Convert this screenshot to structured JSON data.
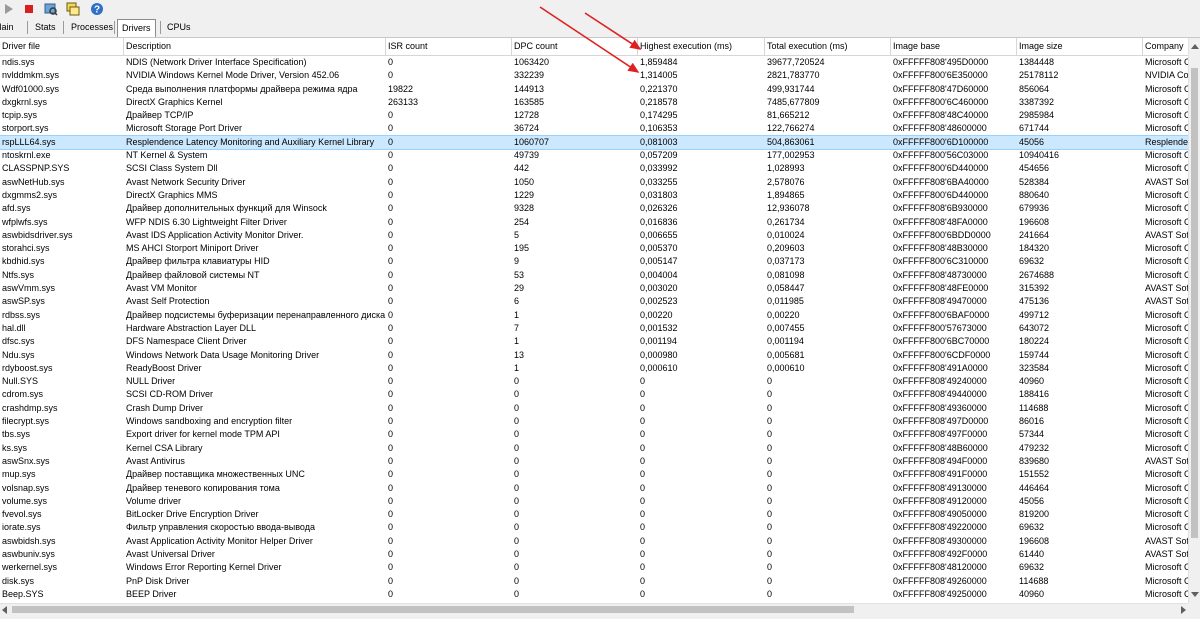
{
  "toolbar": {
    "icons": [
      "play-icon",
      "stop-icon",
      "driver-scan-icon",
      "window-icon",
      "help-icon"
    ]
  },
  "tabs": [
    {
      "label": "Main"
    },
    {
      "label": "Stats"
    },
    {
      "label": "Processes"
    },
    {
      "label": "Drivers",
      "active": true
    },
    {
      "label": "CPUs"
    }
  ],
  "columns": [
    "Driver file",
    "Description",
    "ISR count",
    "DPC count",
    "Highest execution (ms)",
    "Total execution (ms)",
    "Image base",
    "Image size",
    "Company"
  ],
  "rows": [
    [
      "ndis.sys",
      "NDIS (Network Driver Interface Specification)",
      "0",
      "1063420",
      "1,859484",
      "39677,720524",
      "0xFFFFF808'495D0000",
      "1384448",
      "Microsoft C"
    ],
    [
      "nvlddmkm.sys",
      "NVIDIA Windows Kernel Mode Driver, Version 452.06",
      "0",
      "332239",
      "1,314005",
      "2821,783770",
      "0xFFFFF800'6E350000",
      "25178112",
      "NVIDIA Cor"
    ],
    [
      "Wdf01000.sys",
      "Среда выполнения платформы драйвера режима ядра",
      "19822",
      "144913",
      "0,221370",
      "499,931744",
      "0xFFFFF808'47D60000",
      "856064",
      "Microsoft C"
    ],
    [
      "dxgkrnl.sys",
      "DirectX Graphics Kernel",
      "263133",
      "163585",
      "0,218578",
      "7485,677809",
      "0xFFFFF800'6C460000",
      "3387392",
      "Microsoft C"
    ],
    [
      "tcpip.sys",
      "Драйвер TCP/IP",
      "0",
      "12728",
      "0,174295",
      "81,665212",
      "0xFFFFF808'48C40000",
      "2985984",
      "Microsoft C"
    ],
    [
      "storport.sys",
      "Microsoft Storage Port Driver",
      "0",
      "36724",
      "0,106353",
      "122,766274",
      "0xFFFFF808'48600000",
      "671744",
      "Microsoft C"
    ],
    [
      "rspLLL64.sys",
      "Resplendence Latency Monitoring and Auxiliary Kernel Library",
      "0",
      "1060707",
      "0,081003",
      "504,863061",
      "0xFFFFF800'6D100000",
      "45056",
      "Resplender"
    ],
    [
      "ntoskrnl.exe",
      "NT Kernel & System",
      "0",
      "49739",
      "0,057209",
      "177,002953",
      "0xFFFFF800'56C03000",
      "10940416",
      "Microsoft C"
    ],
    [
      "CLASSPNP.SYS",
      "SCSI Class System Dll",
      "0",
      "442",
      "0,033992",
      "1,028993",
      "0xFFFFF800'6D440000",
      "454656",
      "Microsoft C"
    ],
    [
      "aswNetHub.sys",
      "Avast Network Security Driver",
      "0",
      "1050",
      "0,033255",
      "2,578076",
      "0xFFFFF808'6BA40000",
      "528384",
      "AVAST Soft"
    ],
    [
      "dxgmms2.sys",
      "DirectX Graphics MMS",
      "0",
      "1229",
      "0,031803",
      "1,894865",
      "0xFFFFF800'6D440000",
      "880640",
      "Microsoft C"
    ],
    [
      "afd.sys",
      "Драйвер дополнительных функций для Winsock",
      "0",
      "9328",
      "0,026326",
      "12,936078",
      "0xFFFFF808'6B930000",
      "679936",
      "Microsoft C"
    ],
    [
      "wfplwfs.sys",
      "WFP NDIS 6.30 Lightweight Filter Driver",
      "0",
      "254",
      "0,016836",
      "0,261734",
      "0xFFFFF808'48FA0000",
      "196608",
      "Microsoft C"
    ],
    [
      "aswbidsdriver.sys",
      "Avast IDS Application Activity Monitor Driver.",
      "0",
      "5",
      "0,006655",
      "0,010024",
      "0xFFFFF800'6BDD0000",
      "241664",
      "AVAST Soft"
    ],
    [
      "storahci.sys",
      "MS AHCI Storport Miniport Driver",
      "0",
      "195",
      "0,005370",
      "0,209603",
      "0xFFFFF808'48B30000",
      "184320",
      "Microsoft C"
    ],
    [
      "kbdhid.sys",
      "Драйвер фильтра клавиатуры HID",
      "0",
      "9",
      "0,005147",
      "0,037173",
      "0xFFFFF800'6C310000",
      "69632",
      "Microsoft C"
    ],
    [
      "Ntfs.sys",
      "Драйвер файловой системы NT",
      "0",
      "53",
      "0,004004",
      "0,081098",
      "0xFFFFF808'48730000",
      "2674688",
      "Microsoft C"
    ],
    [
      "aswVmm.sys",
      "Avast VM Monitor",
      "0",
      "29",
      "0,003020",
      "0,058447",
      "0xFFFFF808'48FE0000",
      "315392",
      "AVAST Soft"
    ],
    [
      "aswSP.sys",
      "Avast Self Protection",
      "0",
      "6",
      "0,002523",
      "0,011985",
      "0xFFFFF808'49470000",
      "475136",
      "AVAST Soft"
    ],
    [
      "rdbss.sys",
      "Драйвер подсистемы буферизации перенаправленного диска",
      "0",
      "1",
      "0,00220",
      "0,00220",
      "0xFFFFF800'6BAF0000",
      "499712",
      "Microsoft C"
    ],
    [
      "hal.dll",
      "Hardware Abstraction Layer DLL",
      "0",
      "7",
      "0,001532",
      "0,007455",
      "0xFFFFF800'57673000",
      "643072",
      "Microsoft C"
    ],
    [
      "dfsc.sys",
      "DFS Namespace Client Driver",
      "0",
      "1",
      "0,001194",
      "0,001194",
      "0xFFFFF800'6BC70000",
      "180224",
      "Microsoft C"
    ],
    [
      "Ndu.sys",
      "Windows Network Data Usage Monitoring Driver",
      "0",
      "13",
      "0,000980",
      "0,005681",
      "0xFFFFF800'6CDF0000",
      "159744",
      "Microsoft C"
    ],
    [
      "rdyboost.sys",
      "ReadyBoost Driver",
      "0",
      "1",
      "0,000610",
      "0,000610",
      "0xFFFFF808'491A0000",
      "323584",
      "Microsoft C"
    ],
    [
      "Null.SYS",
      "NULL Driver",
      "0",
      "0",
      "0",
      "0",
      "0xFFFFF808'49240000",
      "40960",
      "Microsoft C"
    ],
    [
      "cdrom.sys",
      "SCSI CD-ROM Driver",
      "0",
      "0",
      "0",
      "0",
      "0xFFFFF808'49440000",
      "188416",
      "Microsoft C"
    ],
    [
      "crashdmp.sys",
      "Crash Dump Driver",
      "0",
      "0",
      "0",
      "0",
      "0xFFFFF808'49360000",
      "114688",
      "Microsoft C"
    ],
    [
      "filecrypt.sys",
      "Windows sandboxing and encryption filter",
      "0",
      "0",
      "0",
      "0",
      "0xFFFFF808'497D0000",
      "86016",
      "Microsoft C"
    ],
    [
      "tbs.sys",
      "Export driver for kernel mode TPM API",
      "0",
      "0",
      "0",
      "0",
      "0xFFFFF808'497F0000",
      "57344",
      "Microsoft C"
    ],
    [
      "ks.sys",
      "Kernel CSA Library",
      "0",
      "0",
      "0",
      "0",
      "0xFFFFF808'48B60000",
      "479232",
      "Microsoft C"
    ],
    [
      "aswSnx.sys",
      "Avast Antivirus",
      "0",
      "0",
      "0",
      "0",
      "0xFFFFF808'494F0000",
      "839680",
      "AVAST Soft"
    ],
    [
      "mup.sys",
      "Драйвер поставщика множественных UNC",
      "0",
      "0",
      "0",
      "0",
      "0xFFFFF808'491F0000",
      "151552",
      "Microsoft C"
    ],
    [
      "volsnap.sys",
      "Драйвер теневого копирования тома",
      "0",
      "0",
      "0",
      "0",
      "0xFFFFF808'49130000",
      "446464",
      "Microsoft C"
    ],
    [
      "volume.sys",
      "Volume driver",
      "0",
      "0",
      "0",
      "0",
      "0xFFFFF808'49120000",
      "45056",
      "Microsoft C"
    ],
    [
      "fvevol.sys",
      "BitLocker Drive Encryption Driver",
      "0",
      "0",
      "0",
      "0",
      "0xFFFFF808'49050000",
      "819200",
      "Microsoft C"
    ],
    [
      "iorate.sys",
      "Фильтр управления скоростью ввода-вывода",
      "0",
      "0",
      "0",
      "0",
      "0xFFFFF808'49220000",
      "69632",
      "Microsoft C"
    ],
    [
      "aswbidsh.sys",
      "Avast Application Activity Monitor Helper Driver",
      "0",
      "0",
      "0",
      "0",
      "0xFFFFF808'49300000",
      "196608",
      "AVAST Soft"
    ],
    [
      "aswbuniv.sys",
      "Avast Universal Driver",
      "0",
      "0",
      "0",
      "0",
      "0xFFFFF808'492F0000",
      "61440",
      "AVAST Soft"
    ],
    [
      "werkernel.sys",
      "Windows Error Reporting Kernel Driver",
      "0",
      "0",
      "0",
      "0",
      "0xFFFFF808'48120000",
      "69632",
      "Microsoft C"
    ],
    [
      "disk.sys",
      "PnP Disk Driver",
      "0",
      "0",
      "0",
      "0",
      "0xFFFFF808'49260000",
      "114688",
      "Microsoft C"
    ],
    [
      "Beep.SYS",
      "BEEP Driver",
      "0",
      "0",
      "0",
      "0",
      "0xFFFFF808'49250000",
      "40960",
      "Microsoft C"
    ]
  ],
  "selected_row": 6,
  "colors": {
    "selection": "#cce8ff",
    "annotation_arrow": "#e02020"
  }
}
